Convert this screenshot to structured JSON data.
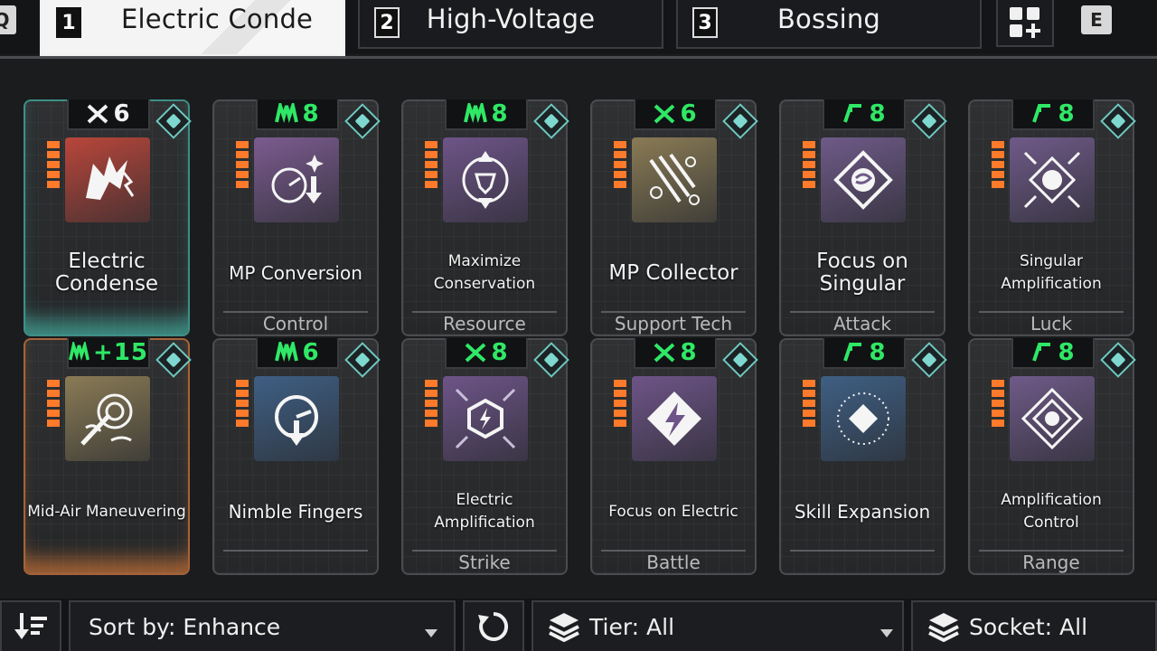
{
  "keys": {
    "prev": "Q",
    "next": "E"
  },
  "tabs": [
    {
      "num": "1",
      "label": "Electric Conde",
      "active": true
    },
    {
      "num": "2",
      "label": "High-Voltage",
      "active": false
    },
    {
      "num": "3",
      "label": "Bossing",
      "active": false
    }
  ],
  "add_tab_icon": "add-preset-icon",
  "cards": [
    {
      "stat": "6",
      "stat_icon": "cross-blades-icon",
      "stat_color": "white",
      "name": "Electric Condense",
      "category": "",
      "icon": "lightning-beast-icon",
      "icon_color": "#b9463a",
      "equipped": "teal"
    },
    {
      "stat": "8",
      "stat_icon": "m-rank-icon",
      "stat_color": "green",
      "name": "MP Conversion",
      "category": "Control",
      "icon": "gauge-down-icon",
      "icon_color": "#7b5b8f",
      "equipped": ""
    },
    {
      "stat": "8",
      "stat_icon": "m-rank-icon",
      "stat_color": "green",
      "name": "Maximize Conservation",
      "category": "Resource",
      "icon": "arrows-shield-icon",
      "icon_color": "#6e5488",
      "equipped": ""
    },
    {
      "stat": "6",
      "stat_icon": "cross-blades-icon",
      "stat_color": "green",
      "name": "MP Collector",
      "category": "Support Tech",
      "icon": "claw-targets-icon",
      "icon_color": "#8a7b55",
      "equipped": ""
    },
    {
      "stat": "8",
      "stat_icon": "gamma-rank-icon",
      "stat_color": "green",
      "name": "Focus on Singular",
      "category": "Attack",
      "icon": "singular-diamond-icon",
      "icon_color": "#6f5a88",
      "equipped": ""
    },
    {
      "stat": "8",
      "stat_icon": "gamma-rank-icon",
      "stat_color": "green",
      "name": "Singular Amplification",
      "category": "Luck",
      "icon": "singular-arrows-icon",
      "icon_color": "#6f5a88",
      "equipped": ""
    },
    {
      "stat": "+15",
      "stat_icon": "m-rank-icon",
      "stat_color": "green",
      "name": "Mid-Air Maneuvering",
      "category": "",
      "icon": "aerial-dash-icon",
      "icon_color": "#8a7b55",
      "equipped": "orange"
    },
    {
      "stat": "6",
      "stat_icon": "m-rank-icon",
      "stat_color": "green",
      "name": "Nimble Fingers",
      "category": "",
      "icon": "dial-arrow-icon",
      "icon_color": "#3f5f84",
      "equipped": ""
    },
    {
      "stat": "8",
      "stat_icon": "cross-blades-icon",
      "stat_color": "green",
      "name": "Electric Amplification",
      "category": "Strike",
      "icon": "hex-bolt-icon",
      "icon_color": "#6e5488",
      "equipped": ""
    },
    {
      "stat": "8",
      "stat_icon": "cross-blades-icon",
      "stat_color": "green",
      "name": "Focus on Electric",
      "category": "Battle",
      "icon": "bolt-diamond-icon",
      "icon_color": "#6e5488",
      "equipped": ""
    },
    {
      "stat": "8",
      "stat_icon": "gamma-rank-icon",
      "stat_color": "green",
      "name": "Skill Expansion",
      "category": "",
      "icon": "radiant-diamond-icon",
      "icon_color": "#3f5f84",
      "equipped": ""
    },
    {
      "stat": "8",
      "stat_icon": "gamma-rank-icon",
      "stat_color": "green",
      "name": "Amplification Control",
      "category": "Range",
      "icon": "ornate-diamond-icon",
      "icon_color": "#6f5a88",
      "equipped": ""
    }
  ],
  "bottom": {
    "sort_label": "Sort by: Enhance",
    "tier_label": "Tier: All",
    "socket_label": "Socket: All"
  },
  "colors": {
    "accent_green": "#2fe866",
    "teal_glow": "#50dcc8",
    "orange_glow": "#ff8c3c",
    "level_bars": "#ff7a2a"
  }
}
